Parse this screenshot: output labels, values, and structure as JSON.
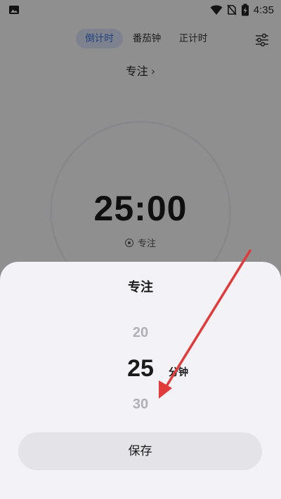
{
  "status_bar": {
    "time": "4:35",
    "icons": [
      "image-icon",
      "wifi-icon",
      "no-sim-icon",
      "battery-charging-icon"
    ]
  },
  "tabs": [
    {
      "label": "倒计时",
      "active": true
    },
    {
      "label": "番茄钟",
      "active": false
    },
    {
      "label": "正计时",
      "active": false
    }
  ],
  "settings_icon": "sliders-icon",
  "focus_label": "专注",
  "timer": {
    "display": "25:00",
    "sub_label": "专注"
  },
  "sheet": {
    "title": "专注",
    "picker": {
      "prev": "20",
      "current": "25",
      "next": "30",
      "unit": "分钟"
    },
    "save_label": "保存"
  },
  "colors": {
    "accent": "#3a6bd6",
    "active_tab_bg": "#d7e1f5",
    "annotation_arrow": "#e03a3a"
  }
}
